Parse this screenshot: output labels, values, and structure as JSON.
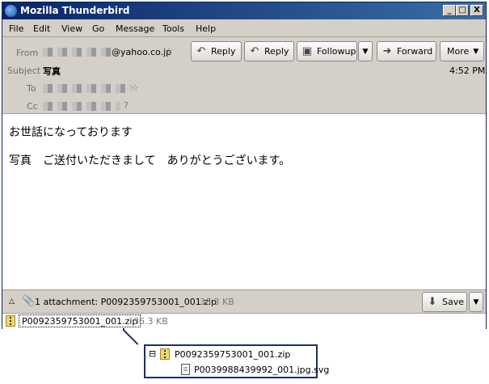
{
  "window": {
    "title": "Mozilla Thunderbird",
    "min": "_",
    "max": "□",
    "close": "X"
  },
  "menu": [
    "File",
    "Edit",
    "View",
    "Go",
    "Message",
    "Tools",
    "Help"
  ],
  "header": {
    "from_label": "From",
    "from_domain": "@yahoo.co.jp",
    "subject_label": "Subject",
    "subject": "写真",
    "to_label": "To",
    "cc_label": "Cc",
    "time": "4:52 PM",
    "star": "☆",
    "cc_mark": "?"
  },
  "toolbar": {
    "reply": "Reply",
    "reply_all": "Reply",
    "followup": "Followup",
    "forward": "Forward",
    "more": "More"
  },
  "body": {
    "line1": "お世話になっております",
    "line2": "写真　ご送付いただきまして　ありがとうございます。"
  },
  "attachment": {
    "summary": "1 attachment: P0092359753001_001.zip",
    "size": "36.3 KB",
    "save": "Save",
    "filename": "P0092359753001_001.zip",
    "list_size": "36.3 KB"
  },
  "popup": {
    "zip_name": "P0092359753001_001.zip",
    "child_name": "P0039988439992_001.jpg.svg",
    "expander": "⊟"
  },
  "colors": {
    "titlebar": "#0a246a",
    "window_bg": "#d4d0c8",
    "accent": "#1e2d6b"
  }
}
